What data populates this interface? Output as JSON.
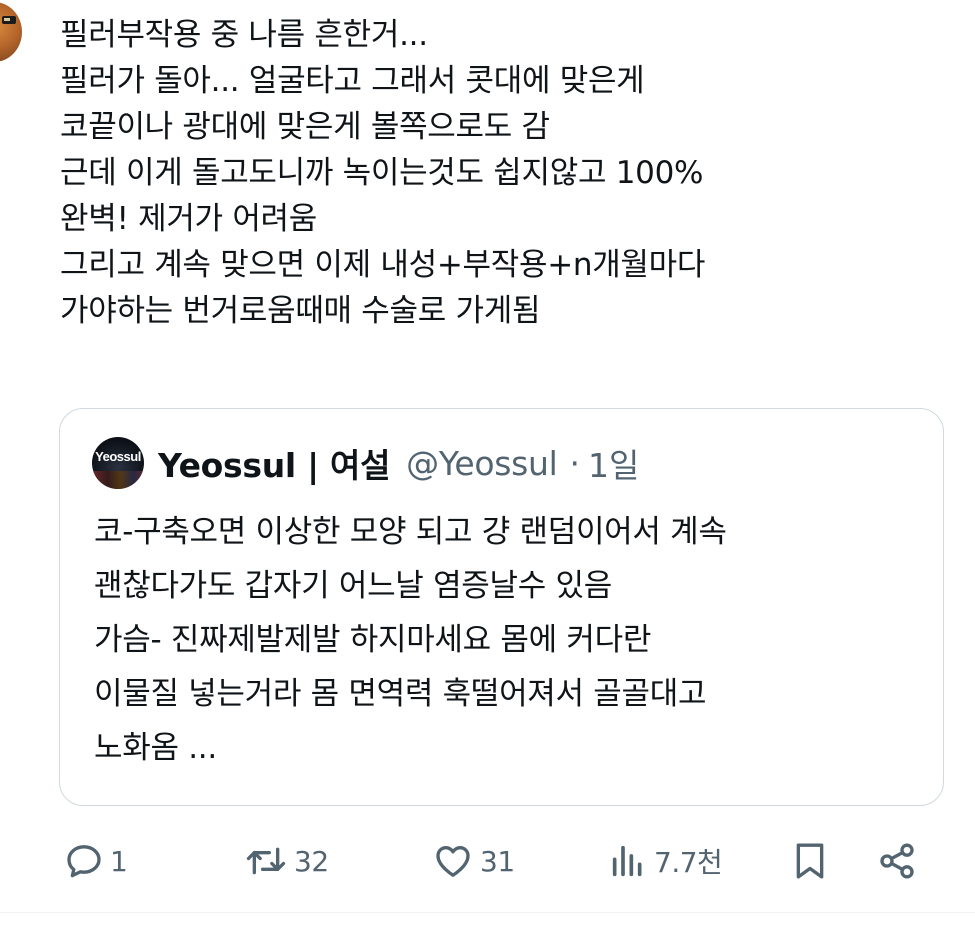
{
  "post": {
    "lines": [
      "필러부작용 중 나름 흔한거...",
      "필러가 돌아... 얼굴타고 그래서 콧대에 맞은게",
      "코끝이나 광대에 맞은게 볼쪽으로도 감",
      "근데 이게 돌고도니까 녹이는것도 쉽지않고 100%",
      "완벽! 제거가 어려움",
      "그리고 계속 맞으면 이제 내성+부작용+n개월마다",
      "가야하는 번거로움때매 수술로 가게됨"
    ]
  },
  "quote": {
    "avatar_text": "Yeossul",
    "display_name": "Yeossul | 여설",
    "handle": "@Yeossul",
    "separator": "·",
    "time": "1일",
    "lines": [
      "코-구축오면 이상한 모양 되고 걍 랜덤이어서 계속",
      "괜찮다가도 갑자기 어느날 염증날수 있음",
      "가슴- 진짜제발제발 하지마세요 몸에 커다란",
      "이물질 넣는거라 몸 면역력 훅떨어져서 골골대고",
      "노화옴 ..."
    ]
  },
  "actions": {
    "reply": {
      "icon": "reply-icon",
      "count": "1"
    },
    "retweet": {
      "icon": "retweet-icon",
      "count": "32"
    },
    "like": {
      "icon": "heart-icon",
      "count": "31"
    },
    "views": {
      "icon": "views-icon",
      "count": "7.7천"
    },
    "bookmark": {
      "icon": "bookmark-icon"
    },
    "share": {
      "icon": "share-icon"
    }
  },
  "colors": {
    "text": "#0f1419",
    "secondary": "#536471",
    "border": "#cfd9de"
  }
}
